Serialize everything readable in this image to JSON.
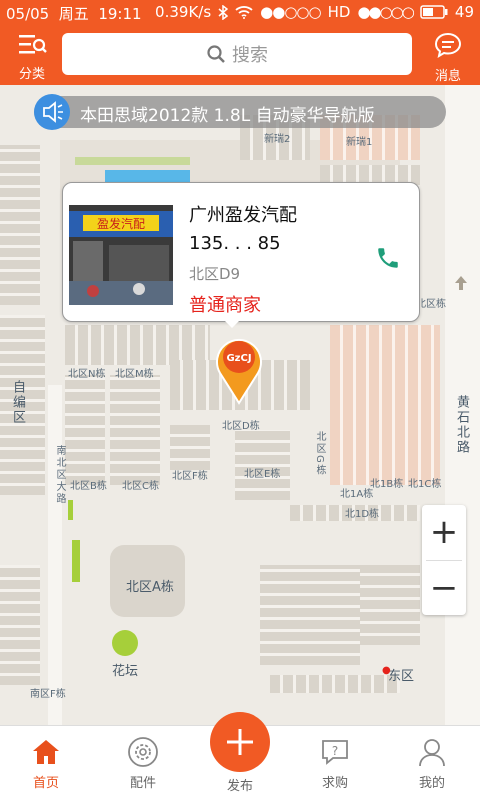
{
  "status_bar": {
    "date": "05/05",
    "weekday": "周五",
    "time": "19:11",
    "speed": "0.39K/s",
    "network": "HD",
    "battery": "49"
  },
  "header": {
    "category_label": "分类",
    "search_placeholder": "搜索",
    "messages_label": "消息"
  },
  "notice": {
    "text": "本田思域2012款 1.8L 自动豪华导航版"
  },
  "shop_card": {
    "name": "广州盈发汽配",
    "phone": "135.  .   . 85",
    "location": "北区D9",
    "type": "普通商家",
    "photo_sign": "盈发汽配"
  },
  "map_labels": {
    "new_2": "新瑞2",
    "new_1": "新瑞1",
    "north_n": "北区N栋",
    "north_m": "北区M栋",
    "north_d": "北区D栋",
    "north_e": "北区E栋",
    "north_f": "北区F栋",
    "north_b": "北区B栋",
    "north_c": "北区C栋",
    "north_g": "北区G栋",
    "north_1a": "北1A栋",
    "north_1b": "北1B栋",
    "north_1c": "北1C栋",
    "north_1d": "北1D栋",
    "north_a": "北区A栋",
    "south_f": "南区F栋",
    "garden": "花坛",
    "east": "东区",
    "zibian": "自编区",
    "huangshi": "黄石北路",
    "south_north_road": "南北区大路",
    "north_building": "北区栋"
  },
  "pin_label": "GzCJ",
  "zoom": {
    "plus": "+",
    "minus": "−"
  },
  "tabs": [
    {
      "label": "首页",
      "icon": "home-icon",
      "active": true
    },
    {
      "label": "配件",
      "icon": "gear-icon",
      "active": false
    },
    {
      "label": "发布",
      "icon": "plus-icon",
      "active": false
    },
    {
      "label": "求购",
      "icon": "question-chat-icon",
      "active": false
    },
    {
      "label": "我的",
      "icon": "user-icon",
      "active": false
    }
  ],
  "colors": {
    "brand": "#f15a24",
    "price_red": "#e5231c",
    "phone_green": "#1f9e7a",
    "notice_blue": "#3d8fe0"
  }
}
